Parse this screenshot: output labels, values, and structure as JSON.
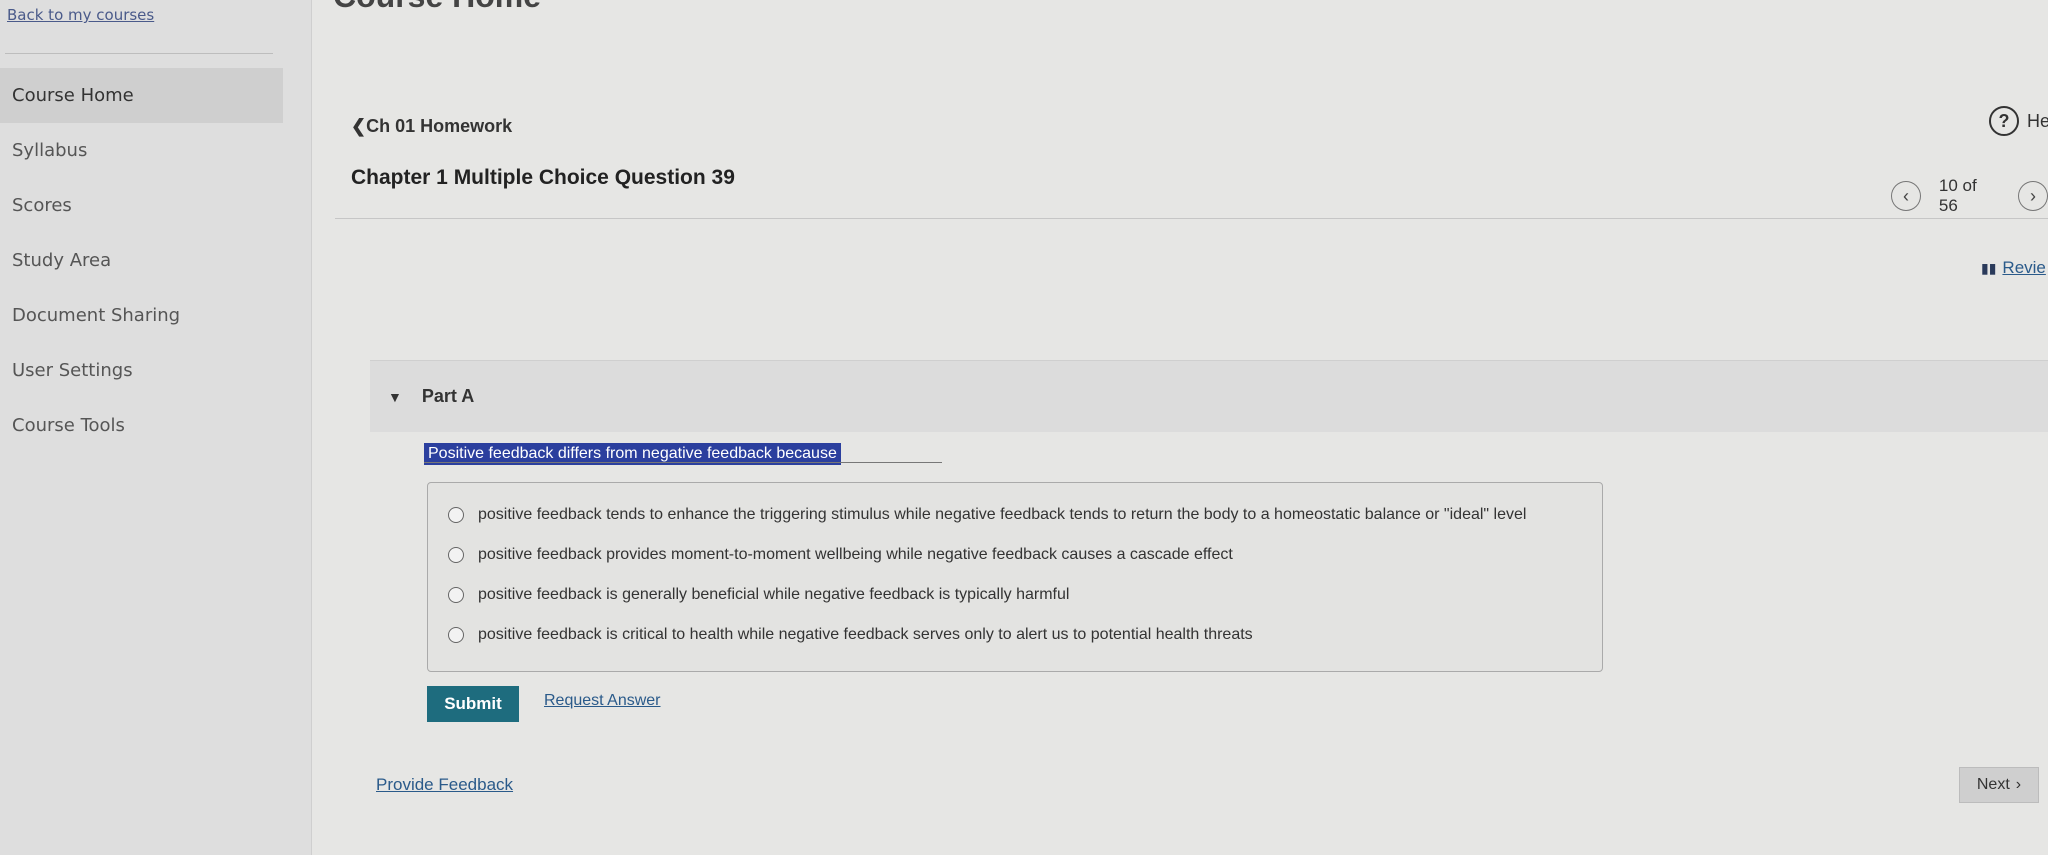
{
  "sidebar": {
    "back_link": "Back to my courses",
    "items": [
      {
        "label": "Course Home",
        "active": true
      },
      {
        "label": "Syllabus"
      },
      {
        "label": "Scores"
      },
      {
        "label": "Study Area"
      },
      {
        "label": "Document Sharing"
      },
      {
        "label": "User Settings"
      },
      {
        "label": "Course Tools"
      }
    ]
  },
  "header": {
    "page_title_cut": "Course Home",
    "breadcrumb": "Ch 01 Homework",
    "breadcrumb_icon": "chevron-left-icon",
    "question_title": "Chapter 1 Multiple Choice Question 39",
    "help_label": "He",
    "pager": {
      "text": "10 of 56"
    },
    "review_label": "Revie"
  },
  "part": {
    "label": "Part A",
    "question": "Positive feedback differs from negative feedback because",
    "choices": [
      "positive feedback tends to enhance the triggering stimulus while negative feedback tends to return the body to a homeostatic balance or \"ideal\" level",
      "positive feedback provides moment-to-moment wellbeing while negative feedback causes a cascade effect",
      "positive feedback is generally beneficial while negative feedback is typically harmful",
      "positive feedback is critical to health while negative feedback serves only to alert us to potential health threats"
    ],
    "submit_label": "Submit",
    "request_label": "Request Answer"
  },
  "footer": {
    "feedback_label": "Provide Feedback",
    "next_label": "Next"
  },
  "colors": {
    "accent": "#1e6c7e",
    "link": "#2a5a8a",
    "highlight": "#2b3f9e"
  }
}
